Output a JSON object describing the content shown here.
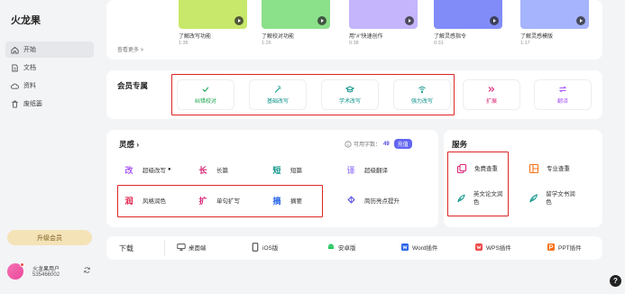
{
  "app": {
    "title": "火龙果"
  },
  "sidebar": {
    "items": [
      {
        "label": "开始",
        "icon": "home-icon"
      },
      {
        "label": "文档",
        "icon": "document-icon"
      },
      {
        "label": "资料",
        "icon": "cloud-icon"
      },
      {
        "label": "废纸篓",
        "icon": "trash-icon"
      }
    ],
    "upgrade_label": "升级会员"
  },
  "user": {
    "name": "火龙果用户",
    "id": "535466002"
  },
  "videos": {
    "more_label": "查看更多 >",
    "items": [
      {
        "title": "了解改写功能",
        "duration": "1:36",
        "color": "#c7e86a"
      },
      {
        "title": "了解校对功能",
        "duration": "1:26",
        "color": "#8be08a"
      },
      {
        "title": "用\"#\"快速创作",
        "duration": "0:38",
        "color": "#c4b5fd"
      },
      {
        "title": "了解灵感指令",
        "duration": "0:31",
        "color": "#818cf8"
      },
      {
        "title": "了解灵感模版",
        "duration": "1:17",
        "color": "#a5b4fc"
      }
    ]
  },
  "member": {
    "title": "会员专属",
    "buttons": [
      {
        "label": "纠错校对",
        "icon": "check-icon",
        "color": "#16a34a"
      },
      {
        "label": "基础改写",
        "icon": "wand-icon",
        "color": "#0d9488"
      },
      {
        "label": "学术改写",
        "icon": "graduation-cap-icon",
        "color": "#0d9488"
      },
      {
        "label": "强力改写",
        "icon": "wifi-pen-icon",
        "color": "#0d9488"
      },
      {
        "label": "扩展",
        "icon": "double-chevron-icon",
        "color": "#db2777"
      },
      {
        "label": "翻译",
        "icon": "swap-icon",
        "color": "#a855f7"
      }
    ]
  },
  "inspiration": {
    "title": "灵感",
    "word_count_label": "可用字数：",
    "word_count": "49",
    "recharge_label": "充值",
    "tools": [
      {
        "glyph": "改",
        "label": "超级改写",
        "color": "#a855f7"
      },
      {
        "glyph": "长",
        "label": "长篇",
        "color": "#db2777"
      },
      {
        "glyph": "短",
        "label": "短篇",
        "color": "#0d9488"
      },
      {
        "glyph": "译",
        "label": "超级翻译",
        "color": "#a78bfa"
      },
      {
        "glyph": "润",
        "label": "风格润色",
        "color": "#e11d48"
      },
      {
        "glyph": "扩",
        "label": "单句扩写",
        "color": "#db2777"
      },
      {
        "glyph": "摘",
        "label": "摘要",
        "color": "#2563eb"
      },
      {
        "glyph": "",
        "label": "简历亮点提升",
        "color": "#4f46e5"
      }
    ]
  },
  "service": {
    "title": "服务",
    "items": [
      {
        "label": "免费查重",
        "icon": "copy-icon",
        "color": "#db2777"
      },
      {
        "label": "专业查重",
        "icon": "layout-icon",
        "color": "#f97316"
      },
      {
        "label": "英文论文润色",
        "icon": "quill-icon",
        "color": "#0d9488"
      },
      {
        "label": "留学文书润色",
        "icon": "quill-icon",
        "color": "#0d9488"
      }
    ]
  },
  "download": {
    "title": "下载",
    "items": [
      {
        "label": "桌面端",
        "icon": "desktop-icon"
      },
      {
        "label": "iOS版",
        "icon": "phone-icon"
      },
      {
        "label": "安卓版",
        "icon": "android-icon"
      },
      {
        "label": "Word插件",
        "icon": "word-icon"
      },
      {
        "label": "WPS插件",
        "icon": "wps-icon"
      },
      {
        "label": "PPT插件",
        "icon": "ppt-icon"
      }
    ]
  },
  "help": {
    "label": "?"
  }
}
